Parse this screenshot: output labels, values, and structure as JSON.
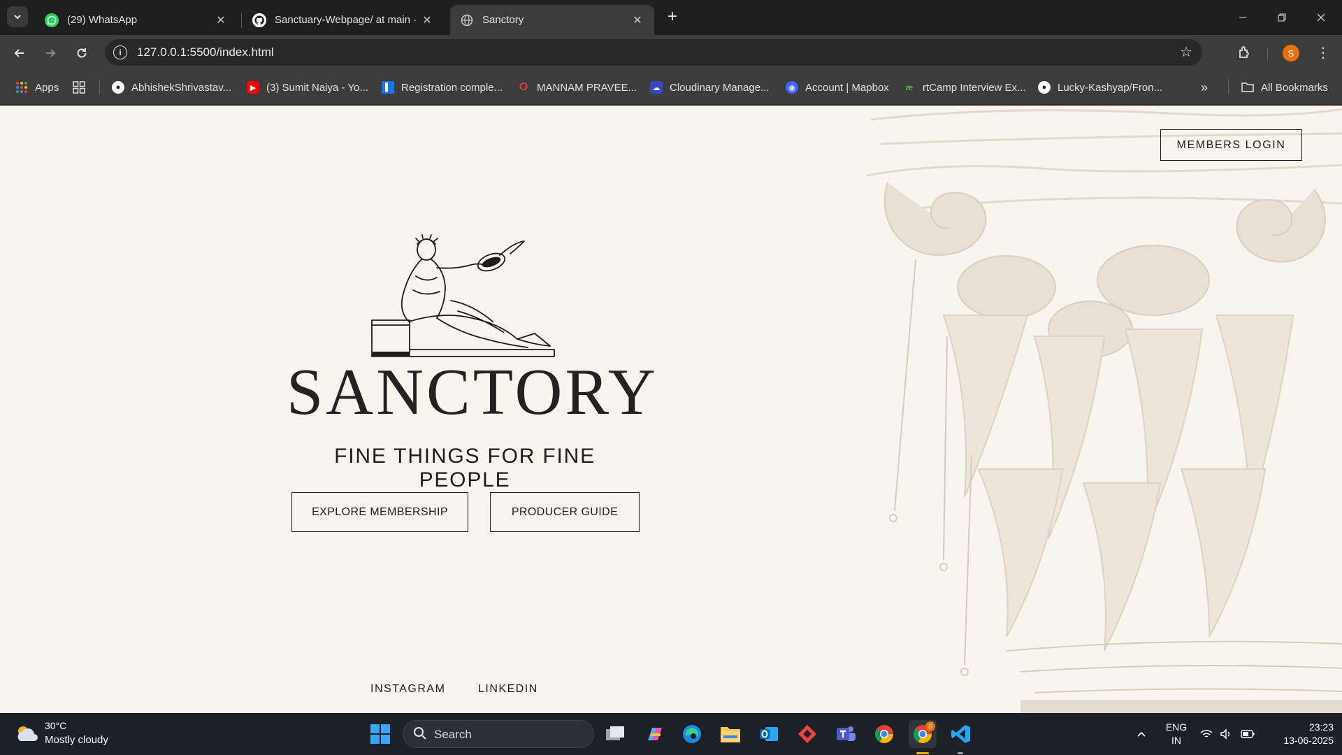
{
  "browser": {
    "tabs": [
      {
        "title": "(29) WhatsApp",
        "favicon": "whatsapp-icon",
        "active": false
      },
      {
        "title": "Sanctuary-Webpage/ at main ·",
        "favicon": "github-icon",
        "active": false
      },
      {
        "title": "Sanctory",
        "favicon": "globe-icon",
        "active": true
      }
    ],
    "url": "127.0.0.1:5500/index.html",
    "profile_initial": "S",
    "bookmarks": [
      {
        "label": "Apps",
        "icon": "apps-grid-icon"
      },
      {
        "label": "AbhishekShrivastav...",
        "icon": "github-icon"
      },
      {
        "label": "(3) Sumit Naiya - Yo...",
        "icon": "youtube-icon"
      },
      {
        "label": "Registration comple...",
        "icon": "form-icon"
      },
      {
        "label": "MANNAM PRAVEE...",
        "icon": "opera-icon"
      },
      {
        "label": "Cloudinary Manage...",
        "icon": "cloudinary-icon"
      },
      {
        "label": "Account | Mapbox",
        "icon": "mapbox-icon"
      },
      {
        "label": "rtCamp Interview Ex...",
        "icon": "rtcamp-icon"
      },
      {
        "label": "Lucky-Kashyap/Fron...",
        "icon": "github-icon"
      }
    ],
    "all_bookmarks_label": "All Bookmarks"
  },
  "page": {
    "members_login": "MEMBERS LOGIN",
    "brand": "SANCTORY",
    "tagline": "FINE THINGS FOR FINE PEOPLE",
    "explore_button": "EXPLORE MEMBERSHIP",
    "producer_button": "PRODUCER GUIDE",
    "social": [
      "INSTAGRAM",
      "LINKEDIN"
    ],
    "colors": {
      "background": "#f8f4ee",
      "ink": "#1d1d1d",
      "ornament": "#e4dccf"
    }
  },
  "taskbar": {
    "weather_temp": "30°C",
    "weather_desc": "Mostly cloudy",
    "search_label": "Search",
    "chrome_badge": "S",
    "lang_line1": "ENG",
    "lang_line2": "IN",
    "time": "23:23",
    "date": "13-06-2025"
  }
}
